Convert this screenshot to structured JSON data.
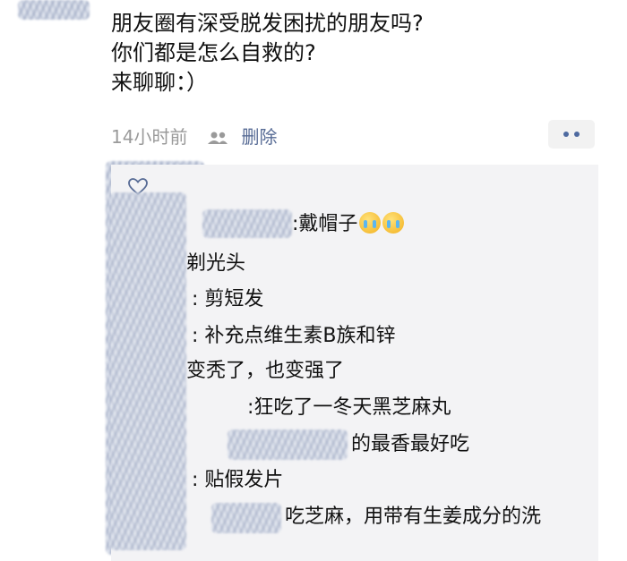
{
  "post": {
    "lines": [
      "朋友圈有深受脱发困扰的朋友吗?",
      "你们都是怎么自救的?",
      "来聊聊：）"
    ],
    "time": "14小时前",
    "delete_label": "删除"
  },
  "comments": [
    {
      "text": ":戴帽子"
    },
    {
      "text": "剃光头"
    },
    {
      "text": ": 剪短发"
    },
    {
      "text": ": 补充点维生素B族和锌"
    },
    {
      "text": "变秃了，也变强了"
    },
    {
      "text": ":狂吃了一冬天黑芝麻丸"
    },
    {
      "text": "的最香最好吃"
    },
    {
      "text": ": 贴假发片"
    },
    {
      "text": "吃芝麻，用带有生姜成分的洗"
    }
  ],
  "icons": {
    "visibility": "people-icon",
    "more": "more-dots-icon",
    "like": "heart-outline-icon",
    "emoji": "crying-face-emoji-icon"
  },
  "colors": {
    "link": "#576b95",
    "time": "#9a9a9a",
    "comment_bg": "#f3f3f5"
  }
}
